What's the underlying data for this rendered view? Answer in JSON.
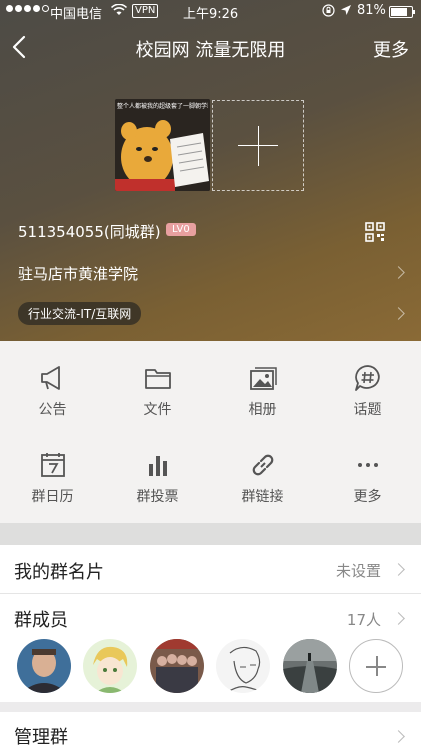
{
  "status_bar": {
    "carrier": "中国电信",
    "vpn": "VPN",
    "time": "上午9:26",
    "battery": "81%",
    "battery_level": 0.81
  },
  "nav": {
    "title": "校园网 流量无限用",
    "more": "更多"
  },
  "photos": {
    "caption": "整个人都被我的超级套了一脚朝学霸卡卡"
  },
  "group": {
    "id_name": "511354055(同城群)",
    "level": "LV0",
    "school": "驻马店市黄淮学院",
    "tag": "行业交流-IT/互联网"
  },
  "features": [
    {
      "label": "公告",
      "icon": "megaphone-icon"
    },
    {
      "label": "文件",
      "icon": "folder-icon"
    },
    {
      "label": "相册",
      "icon": "album-icon"
    },
    {
      "label": "话题",
      "icon": "hashtag-bubble-icon"
    },
    {
      "label": "群日历",
      "icon": "calendar-icon"
    },
    {
      "label": "群投票",
      "icon": "bar-chart-icon"
    },
    {
      "label": "群链接",
      "icon": "link-icon"
    },
    {
      "label": "更多",
      "icon": "more-dots-icon"
    }
  ],
  "rows": {
    "card_label": "我的群名片",
    "card_value": "未设置",
    "members_label": "群成员",
    "members_count": "17人",
    "manage_label": "管理群"
  },
  "colors": {
    "hero_dark": "#4d4b46",
    "hero_gold": "#8a6a36",
    "level_badge": "#e8a0a0"
  }
}
